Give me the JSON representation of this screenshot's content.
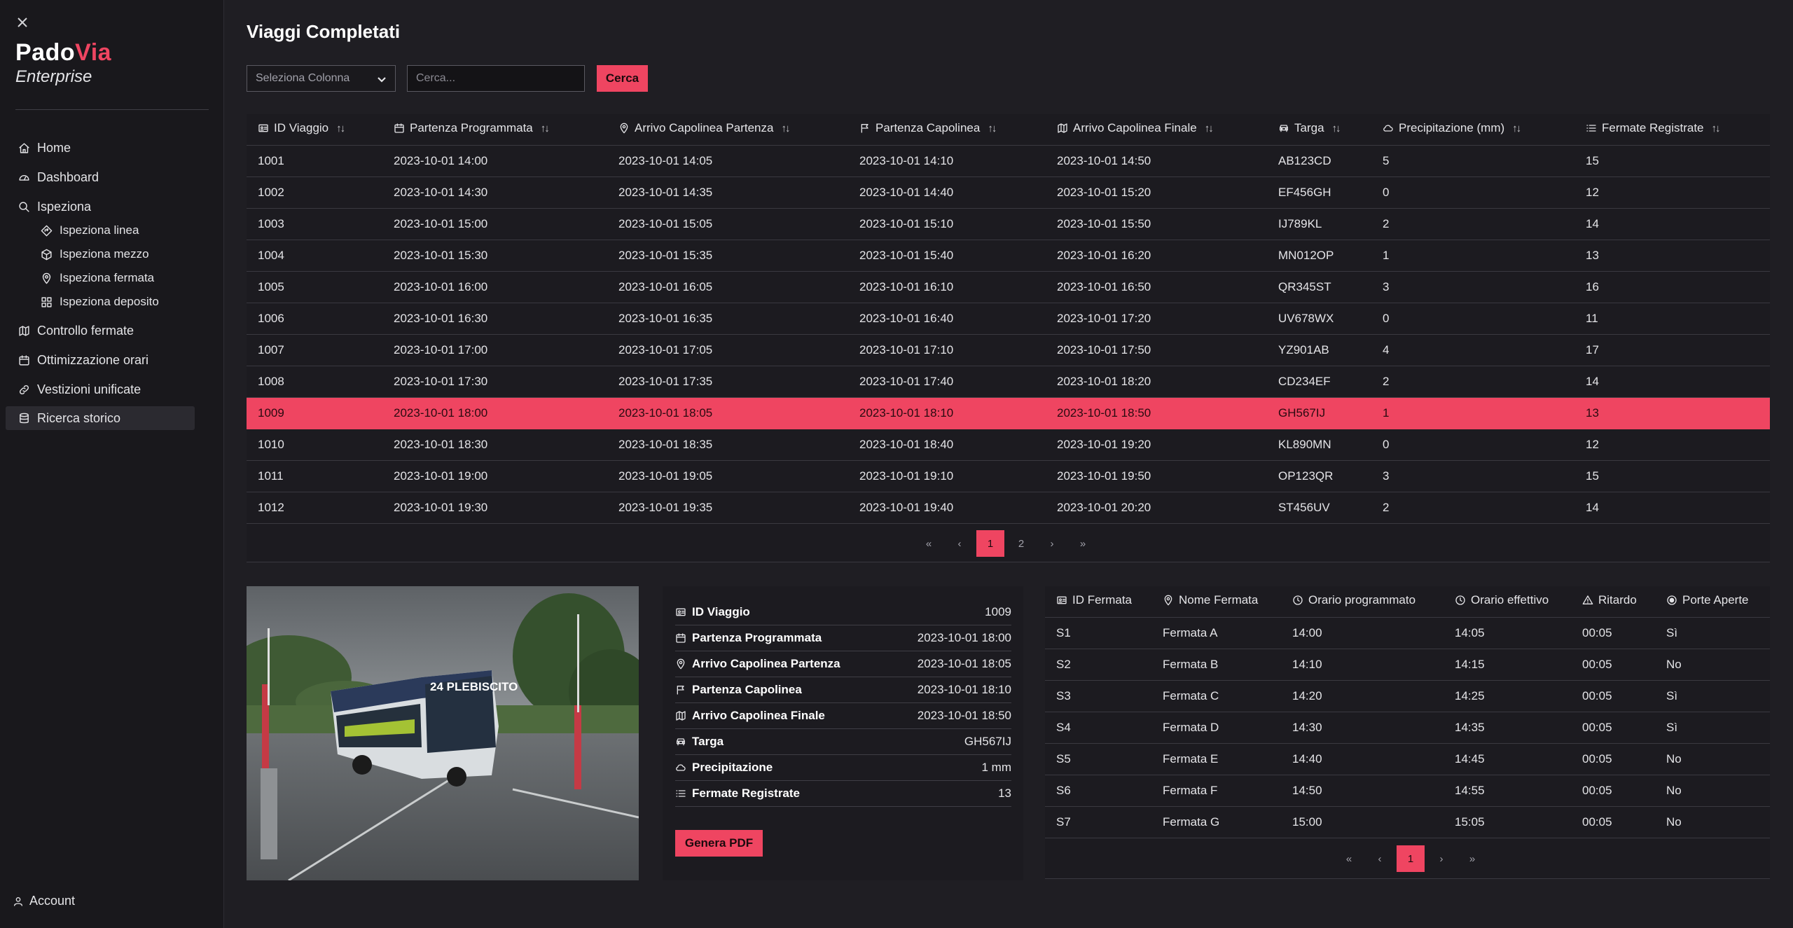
{
  "app": {
    "brand_part1": "Pado",
    "brand_part2": "Via",
    "brand_sub": "Enterprise",
    "accent_color": "#ef4561"
  },
  "sidebar": {
    "items": [
      {
        "label": "Home",
        "icon": "home-icon"
      },
      {
        "label": "Dashboard",
        "icon": "gauge-icon"
      },
      {
        "label": "Ispeziona",
        "icon": "search-icon"
      },
      {
        "label": "Ispeziona linea",
        "icon": "route-diamond-icon"
      },
      {
        "label": "Ispeziona mezzo",
        "icon": "cube-icon"
      },
      {
        "label": "Ispeziona fermata",
        "icon": "map-pin-icon"
      },
      {
        "label": "Ispeziona deposito",
        "icon": "grid-icon"
      },
      {
        "label": "Controllo fermate",
        "icon": "map-icon"
      },
      {
        "label": "Ottimizzazione orari",
        "icon": "calendar-icon"
      },
      {
        "label": "Vestizioni unificate",
        "icon": "link-icon"
      },
      {
        "label": "Ricerca storico",
        "icon": "database-icon"
      }
    ],
    "active": "Ricerca storico",
    "account_label": "Account"
  },
  "main": {
    "title": "Viaggi Completati",
    "column_select": "Seleziona Colonna",
    "search_placeholder": "Cerca...",
    "search_button": "Cerca"
  },
  "trips": {
    "columns": [
      "ID Viaggio",
      "Partenza Programmata",
      "Arrivo Capolinea Partenza",
      "Partenza Capolinea",
      "Arrivo Capolinea Finale",
      "Targa",
      "Precipitazione (mm)",
      "Fermate Registrate"
    ],
    "rows": [
      [
        "1001",
        "2023-10-01 14:00",
        "2023-10-01 14:05",
        "2023-10-01 14:10",
        "2023-10-01 14:50",
        "AB123CD",
        "5",
        "15"
      ],
      [
        "1002",
        "2023-10-01 14:30",
        "2023-10-01 14:35",
        "2023-10-01 14:40",
        "2023-10-01 15:20",
        "EF456GH",
        "0",
        "12"
      ],
      [
        "1003",
        "2023-10-01 15:00",
        "2023-10-01 15:05",
        "2023-10-01 15:10",
        "2023-10-01 15:50",
        "IJ789KL",
        "2",
        "14"
      ],
      [
        "1004",
        "2023-10-01 15:30",
        "2023-10-01 15:35",
        "2023-10-01 15:40",
        "2023-10-01 16:20",
        "MN012OP",
        "1",
        "13"
      ],
      [
        "1005",
        "2023-10-01 16:00",
        "2023-10-01 16:05",
        "2023-10-01 16:10",
        "2023-10-01 16:50",
        "QR345ST",
        "3",
        "16"
      ],
      [
        "1006",
        "2023-10-01 16:30",
        "2023-10-01 16:35",
        "2023-10-01 16:40",
        "2023-10-01 17:20",
        "UV678WX",
        "0",
        "11"
      ],
      [
        "1007",
        "2023-10-01 17:00",
        "2023-10-01 17:05",
        "2023-10-01 17:10",
        "2023-10-01 17:50",
        "YZ901AB",
        "4",
        "17"
      ],
      [
        "1008",
        "2023-10-01 17:30",
        "2023-10-01 17:35",
        "2023-10-01 17:40",
        "2023-10-01 18:20",
        "CD234EF",
        "2",
        "14"
      ],
      [
        "1009",
        "2023-10-01 18:00",
        "2023-10-01 18:05",
        "2023-10-01 18:10",
        "2023-10-01 18:50",
        "GH567IJ",
        "1",
        "13"
      ],
      [
        "1010",
        "2023-10-01 18:30",
        "2023-10-01 18:35",
        "2023-10-01 18:40",
        "2023-10-01 19:20",
        "KL890MN",
        "0",
        "12"
      ],
      [
        "1011",
        "2023-10-01 19:00",
        "2023-10-01 19:05",
        "2023-10-01 19:10",
        "2023-10-01 19:50",
        "OP123QR",
        "3",
        "15"
      ],
      [
        "1012",
        "2023-10-01 19:30",
        "2023-10-01 19:35",
        "2023-10-01 19:40",
        "2023-10-01 20:20",
        "ST456UV",
        "2",
        "14"
      ]
    ],
    "selected_id": "1009",
    "pagination": {
      "first": "«",
      "prev": "‹",
      "pages": [
        "1",
        "2"
      ],
      "current": "1",
      "next": "›",
      "last": "»"
    }
  },
  "photo": {
    "bus_sign": "24 PLEBISCITO"
  },
  "details": {
    "rows": [
      {
        "label": "ID Viaggio",
        "value": "1009",
        "icon": "id-card-icon"
      },
      {
        "label": "Partenza Programmata",
        "value": "2023-10-01 18:00",
        "icon": "calendar-icon"
      },
      {
        "label": "Arrivo Capolinea Partenza",
        "value": "2023-10-01 18:05",
        "icon": "map-pin-icon"
      },
      {
        "label": "Partenza Capolinea",
        "value": "2023-10-01 18:10",
        "icon": "flag-icon"
      },
      {
        "label": "Arrivo Capolinea Finale",
        "value": "2023-10-01 18:50",
        "icon": "map-icon"
      },
      {
        "label": "Targa",
        "value": "GH567IJ",
        "icon": "car-icon"
      },
      {
        "label": "Precipitazione",
        "value": "1 mm",
        "icon": "cloud-icon"
      },
      {
        "label": "Fermate Registrate",
        "value": "13",
        "icon": "list-icon"
      }
    ],
    "pdf_button": "Genera PDF"
  },
  "stops": {
    "columns": [
      "ID Fermata",
      "Nome Fermata",
      "Orario programmato",
      "Orario effettivo",
      "Ritardo",
      "Porte Aperte"
    ],
    "rows": [
      [
        "S1",
        "Fermata A",
        "14:00",
        "14:05",
        "00:05",
        "Sì"
      ],
      [
        "S2",
        "Fermata B",
        "14:10",
        "14:15",
        "00:05",
        "No"
      ],
      [
        "S3",
        "Fermata C",
        "14:20",
        "14:25",
        "00:05",
        "Sì"
      ],
      [
        "S4",
        "Fermata D",
        "14:30",
        "14:35",
        "00:05",
        "Sì"
      ],
      [
        "S5",
        "Fermata E",
        "14:40",
        "14:45",
        "00:05",
        "No"
      ],
      [
        "S6",
        "Fermata F",
        "14:50",
        "14:55",
        "00:05",
        "No"
      ],
      [
        "S7",
        "Fermata G",
        "15:00",
        "15:05",
        "00:05",
        "No"
      ]
    ],
    "pagination": {
      "first": "«",
      "prev": "‹",
      "pages": [
        "1"
      ],
      "current": "1",
      "next": "›",
      "last": "»"
    }
  }
}
